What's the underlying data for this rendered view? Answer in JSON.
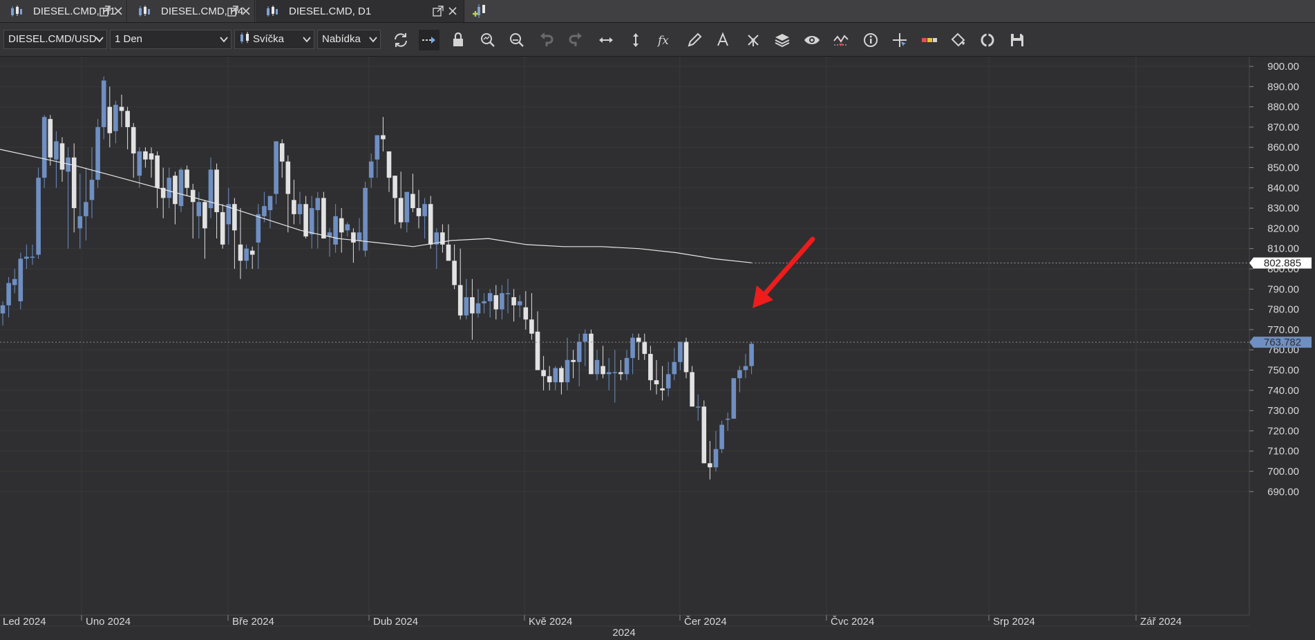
{
  "tabs": [
    {
      "label": "DIESEL.CMD, H1",
      "active": false
    },
    {
      "label": "DIESEL.CMD, H4",
      "active": false
    },
    {
      "label": "DIESEL.CMD, D1",
      "active": true
    }
  ],
  "toolbar": {
    "instrument": "DIESEL.CMD/USD",
    "period": "1 Den",
    "chart_type": "Svíčka",
    "price_side": "Nabídka",
    "icons": [
      "refresh-icon",
      "shift-chart-icon",
      "lock-icon",
      "zoom-in-icon",
      "zoom-out-icon",
      "undo-icon",
      "redo-icon",
      "fit-horizontal-icon",
      "fit-vertical-icon",
      "formula-icon",
      "pencil-icon",
      "text-icon",
      "pattern-icon",
      "layers-icon",
      "eye-icon",
      "signals-icon",
      "info-icon",
      "crosshair-icon",
      "strategy-icon",
      "paint-bucket-icon",
      "sync-icon",
      "save-icon"
    ]
  },
  "colors": {
    "background": "#2f2f31",
    "bull_candle": "#6f8fc2",
    "bear_candle": "#e2e2e2",
    "ma_line": "#e8e8e8",
    "annotation_arrow": "#ee1c1c",
    "current_price_label": "#6f8fc2"
  },
  "chart_data": {
    "type": "candlestick",
    "symbol": "DIESEL.CMD/USD",
    "timeframe": "D1",
    "y_axis": {
      "min": 683,
      "max": 905,
      "ticks": [
        "900.00",
        "890.00",
        "880.00",
        "870.00",
        "860.00",
        "850.00",
        "840.00",
        "830.00",
        "820.00",
        "810.00",
        "800.00",
        "790.00",
        "780.00",
        "770.00",
        "760.00",
        "750.00",
        "740.00",
        "730.00",
        "720.00",
        "710.00",
        "700.00",
        "690.00"
      ]
    },
    "x_axis": {
      "labels": [
        "Led 2024",
        "Uno 2024",
        "Bře 2024",
        "Dub 2024",
        "Kvě 2024",
        "Čer 2024",
        "Čvc 2024",
        "Srp 2024",
        "Zář 2024"
      ],
      "year_label": "2024"
    },
    "price_labels": {
      "moving_average": "802.885",
      "current_price": "763.782"
    },
    "moving_average": {
      "values": [
        859,
        855,
        851,
        846,
        841,
        836,
        831,
        825,
        819,
        815,
        813,
        811,
        814,
        815,
        812,
        811,
        811,
        810,
        808,
        805,
        803
      ]
    },
    "candles": [
      {
        "o": 778,
        "h": 784,
        "l": 772,
        "c": 782
      },
      {
        "o": 782,
        "h": 796,
        "l": 776,
        "c": 793
      },
      {
        "o": 792,
        "h": 800,
        "l": 788,
        "c": 795
      },
      {
        "o": 784,
        "h": 808,
        "l": 780,
        "c": 805
      },
      {
        "o": 805,
        "h": 812,
        "l": 800,
        "c": 806
      },
      {
        "o": 806,
        "h": 812,
        "l": 802,
        "c": 806
      },
      {
        "o": 807,
        "h": 850,
        "l": 805,
        "c": 845
      },
      {
        "o": 845,
        "h": 876,
        "l": 840,
        "c": 875
      },
      {
        "o": 874,
        "h": 876,
        "l": 851,
        "c": 855
      },
      {
        "o": 854,
        "h": 868,
        "l": 840,
        "c": 863
      },
      {
        "o": 862,
        "h": 865,
        "l": 843,
        "c": 849
      },
      {
        "o": 848,
        "h": 860,
        "l": 810,
        "c": 855
      },
      {
        "o": 855,
        "h": 862,
        "l": 818,
        "c": 830
      },
      {
        "o": 820,
        "h": 847,
        "l": 810,
        "c": 826
      },
      {
        "o": 826,
        "h": 850,
        "l": 814,
        "c": 833
      },
      {
        "o": 834,
        "h": 860,
        "l": 825,
        "c": 844
      },
      {
        "o": 844,
        "h": 874,
        "l": 840,
        "c": 870
      },
      {
        "o": 870,
        "h": 895,
        "l": 864,
        "c": 893
      },
      {
        "o": 880,
        "h": 890,
        "l": 860,
        "c": 867
      },
      {
        "o": 868,
        "h": 883,
        "l": 862,
        "c": 881
      },
      {
        "o": 880,
        "h": 886,
        "l": 870,
        "c": 878
      },
      {
        "o": 878,
        "h": 880,
        "l": 859,
        "c": 870
      },
      {
        "o": 870,
        "h": 872,
        "l": 845,
        "c": 857
      },
      {
        "o": 846,
        "h": 860,
        "l": 840,
        "c": 858
      },
      {
        "o": 858,
        "h": 860,
        "l": 850,
        "c": 854
      },
      {
        "o": 857,
        "h": 860,
        "l": 845,
        "c": 854
      },
      {
        "o": 856,
        "h": 858,
        "l": 830,
        "c": 840
      },
      {
        "o": 840,
        "h": 850,
        "l": 825,
        "c": 835
      },
      {
        "o": 835,
        "h": 850,
        "l": 830,
        "c": 845
      },
      {
        "o": 846,
        "h": 848,
        "l": 822,
        "c": 832
      },
      {
        "o": 831,
        "h": 850,
        "l": 828,
        "c": 849
      },
      {
        "o": 849,
        "h": 851,
        "l": 836,
        "c": 840
      },
      {
        "o": 839,
        "h": 842,
        "l": 815,
        "c": 833
      },
      {
        "o": 826,
        "h": 838,
        "l": 815,
        "c": 833
      },
      {
        "o": 833,
        "h": 834,
        "l": 805,
        "c": 820
      },
      {
        "o": 830,
        "h": 855,
        "l": 825,
        "c": 849
      },
      {
        "o": 849,
        "h": 852,
        "l": 815,
        "c": 828
      },
      {
        "o": 828,
        "h": 832,
        "l": 810,
        "c": 812
      },
      {
        "o": 822,
        "h": 840,
        "l": 812,
        "c": 832
      },
      {
        "o": 832,
        "h": 835,
        "l": 800,
        "c": 819
      },
      {
        "o": 812,
        "h": 830,
        "l": 795,
        "c": 804
      },
      {
        "o": 804,
        "h": 812,
        "l": 800,
        "c": 810
      },
      {
        "o": 809,
        "h": 811,
        "l": 800,
        "c": 807
      },
      {
        "o": 813,
        "h": 832,
        "l": 800,
        "c": 827
      },
      {
        "o": 826,
        "h": 838,
        "l": 823,
        "c": 831
      },
      {
        "o": 829,
        "h": 835,
        "l": 820,
        "c": 836
      },
      {
        "o": 837,
        "h": 862,
        "l": 832,
        "c": 863
      },
      {
        "o": 862,
        "h": 864,
        "l": 845,
        "c": 853
      },
      {
        "o": 853,
        "h": 856,
        "l": 818,
        "c": 837
      },
      {
        "o": 834,
        "h": 844,
        "l": 822,
        "c": 827
      },
      {
        "o": 827,
        "h": 838,
        "l": 822,
        "c": 832
      },
      {
        "o": 832,
        "h": 836,
        "l": 815,
        "c": 816
      },
      {
        "o": 817,
        "h": 836,
        "l": 810,
        "c": 830
      },
      {
        "o": 829,
        "h": 838,
        "l": 810,
        "c": 835
      },
      {
        "o": 835,
        "h": 838,
        "l": 815,
        "c": 815
      },
      {
        "o": 816,
        "h": 820,
        "l": 806,
        "c": 818
      },
      {
        "o": 812,
        "h": 832,
        "l": 808,
        "c": 826
      },
      {
        "o": 825,
        "h": 830,
        "l": 808,
        "c": 818
      },
      {
        "o": 819,
        "h": 823,
        "l": 816,
        "c": 822
      },
      {
        "o": 818,
        "h": 820,
        "l": 803,
        "c": 813
      },
      {
        "o": 814,
        "h": 825,
        "l": 809,
        "c": 818
      },
      {
        "o": 809,
        "h": 843,
        "l": 806,
        "c": 840
      },
      {
        "o": 845,
        "h": 857,
        "l": 840,
        "c": 853
      },
      {
        "o": 854,
        "h": 860,
        "l": 845,
        "c": 866
      },
      {
        "o": 866,
        "h": 875,
        "l": 858,
        "c": 864
      },
      {
        "o": 858,
        "h": 855,
        "l": 838,
        "c": 845
      },
      {
        "o": 846,
        "h": 842,
        "l": 822,
        "c": 835
      },
      {
        "o": 835,
        "h": 848,
        "l": 820,
        "c": 823
      },
      {
        "o": 823,
        "h": 835,
        "l": 818,
        "c": 838
      },
      {
        "o": 837,
        "h": 847,
        "l": 828,
        "c": 830
      },
      {
        "o": 830,
        "h": 839,
        "l": 820,
        "c": 826
      },
      {
        "o": 826,
        "h": 835,
        "l": 815,
        "c": 832
      },
      {
        "o": 832,
        "h": 836,
        "l": 810,
        "c": 812
      },
      {
        "o": 812,
        "h": 820,
        "l": 800,
        "c": 818
      },
      {
        "o": 818,
        "h": 822,
        "l": 808,
        "c": 812
      },
      {
        "o": 812,
        "h": 822,
        "l": 808,
        "c": 804
      },
      {
        "o": 804,
        "h": 812,
        "l": 790,
        "c": 792
      },
      {
        "o": 792,
        "h": 810,
        "l": 775,
        "c": 777
      },
      {
        "o": 777,
        "h": 795,
        "l": 775,
        "c": 786
      },
      {
        "o": 786,
        "h": 795,
        "l": 765,
        "c": 778
      },
      {
        "o": 778,
        "h": 790,
        "l": 776,
        "c": 783
      },
      {
        "o": 783,
        "h": 788,
        "l": 778,
        "c": 784
      },
      {
        "o": 784,
        "h": 790,
        "l": 776,
        "c": 788
      },
      {
        "o": 787,
        "h": 792,
        "l": 775,
        "c": 780
      },
      {
        "o": 780,
        "h": 792,
        "l": 775,
        "c": 788
      },
      {
        "o": 788,
        "h": 795,
        "l": 778,
        "c": 788
      },
      {
        "o": 786,
        "h": 790,
        "l": 774,
        "c": 782
      },
      {
        "o": 782,
        "h": 787,
        "l": 776,
        "c": 784
      },
      {
        "o": 781,
        "h": 789,
        "l": 770,
        "c": 775
      },
      {
        "o": 775,
        "h": 788,
        "l": 765,
        "c": 768
      },
      {
        "o": 769,
        "h": 779,
        "l": 758,
        "c": 750
      },
      {
        "o": 750,
        "h": 757,
        "l": 740,
        "c": 747
      },
      {
        "o": 747,
        "h": 752,
        "l": 740,
        "c": 744
      },
      {
        "o": 744,
        "h": 752,
        "l": 740,
        "c": 751
      },
      {
        "o": 751,
        "h": 752,
        "l": 738,
        "c": 744
      },
      {
        "o": 744,
        "h": 766,
        "l": 740,
        "c": 755
      },
      {
        "o": 755,
        "h": 760,
        "l": 746,
        "c": 754
      },
      {
        "o": 754,
        "h": 768,
        "l": 742,
        "c": 764
      },
      {
        "o": 764,
        "h": 770,
        "l": 752,
        "c": 768
      },
      {
        "o": 768,
        "h": 770,
        "l": 748,
        "c": 748
      },
      {
        "o": 748,
        "h": 760,
        "l": 745,
        "c": 755
      },
      {
        "o": 752,
        "h": 762,
        "l": 746,
        "c": 748
      },
      {
        "o": 748,
        "h": 756,
        "l": 740,
        "c": 749
      },
      {
        "o": 749,
        "h": 760,
        "l": 734,
        "c": 749
      },
      {
        "o": 749,
        "h": 755,
        "l": 745,
        "c": 748
      },
      {
        "o": 748,
        "h": 760,
        "l": 745,
        "c": 756
      },
      {
        "o": 756,
        "h": 768,
        "l": 748,
        "c": 766
      },
      {
        "o": 766,
        "h": 768,
        "l": 755,
        "c": 764
      },
      {
        "o": 764,
        "h": 768,
        "l": 755,
        "c": 758
      },
      {
        "o": 758,
        "h": 762,
        "l": 740,
        "c": 745
      },
      {
        "o": 745,
        "h": 755,
        "l": 738,
        "c": 743
      },
      {
        "o": 741,
        "h": 752,
        "l": 735,
        "c": 740
      },
      {
        "o": 741,
        "h": 754,
        "l": 737,
        "c": 748
      },
      {
        "o": 748,
        "h": 761,
        "l": 745,
        "c": 754
      },
      {
        "o": 754,
        "h": 764,
        "l": 750,
        "c": 764
      },
      {
        "o": 764,
        "h": 766,
        "l": 746,
        "c": 749
      },
      {
        "o": 749,
        "h": 752,
        "l": 733,
        "c": 732
      },
      {
        "o": 732,
        "h": 738,
        "l": 725,
        "c": 732
      },
      {
        "o": 732,
        "h": 735,
        "l": 705,
        "c": 704
      },
      {
        "o": 704,
        "h": 715,
        "l": 696,
        "c": 702
      },
      {
        "o": 702,
        "h": 720,
        "l": 700,
        "c": 711
      },
      {
        "o": 711,
        "h": 725,
        "l": 709,
        "c": 723
      },
      {
        "o": 726,
        "h": 729,
        "l": 720,
        "c": 726
      },
      {
        "o": 726,
        "h": 745,
        "l": 726,
        "c": 746
      },
      {
        "o": 746,
        "h": 752,
        "l": 739,
        "c": 750
      },
      {
        "o": 750,
        "h": 758,
        "l": 746,
        "c": 752
      },
      {
        "o": 752,
        "h": 764,
        "l": 748,
        "c": 763
      }
    ]
  }
}
